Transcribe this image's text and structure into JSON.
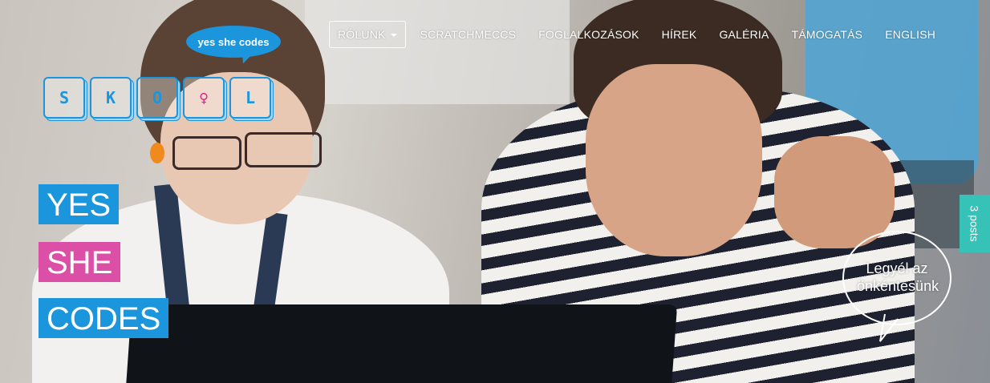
{
  "logo": {
    "bubble_text": "yes she codes",
    "keys": [
      {
        "letter": "S",
        "color": "#1b95dc"
      },
      {
        "letter": "K",
        "color": "#1b95dc"
      },
      {
        "letter": "O",
        "color": "#1b95dc"
      },
      {
        "letter": "♀",
        "color": "#e0228f"
      },
      {
        "letter": "L",
        "color": "#1b95dc"
      }
    ]
  },
  "nav": {
    "items": [
      {
        "label": "RÓLUNK",
        "active": true,
        "has_dropdown": true
      },
      {
        "label": "SCRATCHMECCS"
      },
      {
        "label": "FOGLALKOZÁSOK"
      },
      {
        "label": "HÍREK"
      },
      {
        "label": "GALÉRIA"
      },
      {
        "label": "TÁMOGATÁS"
      },
      {
        "label": "ENGLISH"
      }
    ]
  },
  "tagline": {
    "line1": "YES",
    "line2": "SHE",
    "line3": "CODES"
  },
  "posts_tab": {
    "label": "3 posts"
  },
  "cta": {
    "text": "Legyél az önkéntesünk"
  },
  "colors": {
    "brand_blue": "#1b95dc",
    "brand_pink": "#dc4fa6",
    "posts_tab": "#36c2b6"
  }
}
